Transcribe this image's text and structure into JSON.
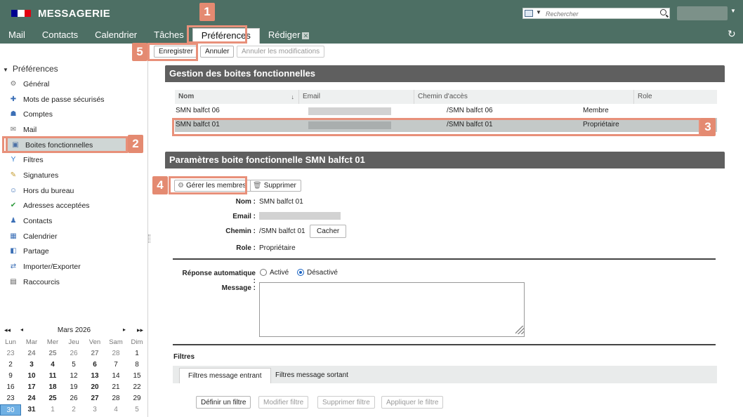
{
  "header": {
    "app_title": "MESSAGERIE",
    "search_placeholder": "Rechercher",
    "flag_colors": [
      "#000091",
      "#ffffff",
      "#e1000f"
    ],
    "nav_tabs": [
      {
        "label": "Mail"
      },
      {
        "label": "Contacts"
      },
      {
        "label": "Calendrier"
      },
      {
        "label": "Tâches"
      },
      {
        "label": "Préférences"
      },
      {
        "label": "Rédiger"
      }
    ],
    "active_tab": "Préférences"
  },
  "toolbar": {
    "save_label": "Enregistrer",
    "cancel_label": "Annuler",
    "cancel_changes_label": "Annuler les modifications"
  },
  "sidebar": {
    "heading": "Préférences",
    "items": [
      {
        "label": "Général",
        "icon": "gear-icon"
      },
      {
        "label": "Mots de passe sécurisés",
        "icon": "key-icon"
      },
      {
        "label": "Comptes",
        "icon": "accounts-icon"
      },
      {
        "label": "Mail",
        "icon": "envelope-icon"
      },
      {
        "label": "Boites fonctionnelles",
        "icon": "shared-mailbox-icon"
      },
      {
        "label": "Filtres",
        "icon": "filter-icon"
      },
      {
        "label": "Signatures",
        "icon": "signature-icon"
      },
      {
        "label": "Hors du bureau",
        "icon": "out-of-office-icon"
      },
      {
        "label": "Adresses acceptées",
        "icon": "shield-check-icon"
      },
      {
        "label": "Contacts",
        "icon": "contact-icon"
      },
      {
        "label": "Calendrier",
        "icon": "calendar-icon"
      },
      {
        "label": "Partage",
        "icon": "share-icon"
      },
      {
        "label": "Importer/Exporter",
        "icon": "import-export-icon"
      },
      {
        "label": "Raccourcis",
        "icon": "shortcut-icon"
      }
    ],
    "active_item": "Boites fonctionnelles"
  },
  "mini_calendar": {
    "month_label": "Mars 2026",
    "prev_year": "◂◂",
    "prev_month": "◂",
    "next_month": "▸",
    "next_year": "▸▸",
    "weekdays": [
      "Lun",
      "Mar",
      "Mer",
      "Jeu",
      "Ven",
      "Sam",
      "Dim"
    ],
    "weeks": [
      [
        "23",
        "24",
        "25",
        "26",
        "27",
        "28",
        "1"
      ],
      [
        "2",
        "3",
        "4",
        "5",
        "6",
        "7",
        "8"
      ],
      [
        "9",
        "10",
        "11",
        "12",
        "13",
        "14",
        "15"
      ],
      [
        "16",
        "17",
        "18",
        "19",
        "20",
        "21",
        "22"
      ],
      [
        "23",
        "24",
        "25",
        "26",
        "27",
        "28",
        "29"
      ],
      [
        "30",
        "31",
        "1",
        "2",
        "3",
        "4",
        "5"
      ]
    ]
  },
  "gestion": {
    "title": "Gestion des boites fonctionnelles",
    "columns": [
      "Nom",
      "Email",
      "Chemin d'accès",
      "Role"
    ],
    "rows": [
      {
        "nom": "SMN balfct 06",
        "chemin": "/SMN balfct 06",
        "role": "Membre"
      },
      {
        "nom": "SMN balfct 01",
        "chemin": "/SMN balfct 01",
        "role": "Propriétaire"
      }
    ]
  },
  "parametres": {
    "title": "Paramètres boite fonctionnelle SMN balfct 01",
    "manage_members_label": "Gérer les membres",
    "delete_label": "Supprimer",
    "nom_label": "Nom :",
    "nom_value": "SMN balfct 01",
    "email_label": "Email :",
    "chemin_label": "Chemin :",
    "chemin_value": "/SMN balfct 01",
    "hide_label": "Cacher",
    "role_label": "Role :",
    "role_value": "Propriétaire",
    "auto_reply_label": "Réponse automatique :",
    "auto_reply_on": "Activé",
    "auto_reply_off": "Désactivé",
    "message_label": "Message :"
  },
  "filtres": {
    "title": "Filtres",
    "tab_incoming": "Filtres message entrant",
    "tab_outgoing": "Filtres message sortant",
    "define_label": "Définir un filtre",
    "modify_label": "Modifier filtre",
    "delete_label": "Supprimer filtre",
    "apply_label": "Appliquer le filtre"
  },
  "annotations": [
    "1",
    "2",
    "3",
    "4",
    "5"
  ],
  "accent_color": "#e48a71"
}
